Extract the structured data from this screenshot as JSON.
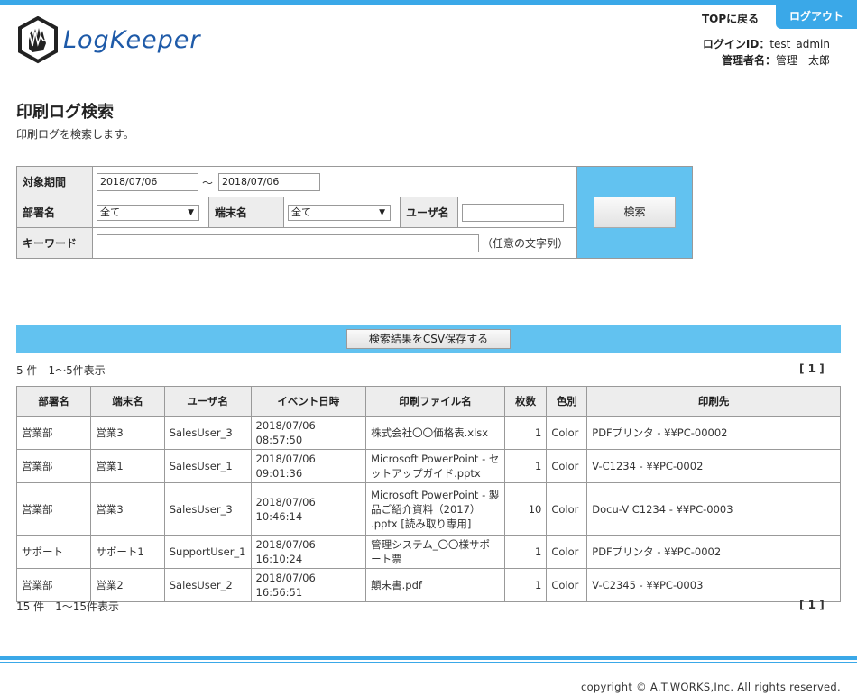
{
  "header": {
    "app_name": "LogKeeper",
    "top_link": "TOPに戻る",
    "logout": "ログアウト",
    "login_id_label": "ログインID：",
    "login_id": "test_admin",
    "manager_label": "管理者名：",
    "manager_name": "管理　太郎"
  },
  "page": {
    "title": "印刷ログ検索",
    "description": "印刷ログを検索します。"
  },
  "search": {
    "period_label": "対象期間",
    "date_from": "2018/07/06",
    "tilde": "～",
    "date_to": "2018/07/06",
    "department_label": "部署名",
    "department_value": "全て",
    "terminal_label": "端末名",
    "terminal_value": "全て",
    "user_label": "ユーザ名",
    "user_value": "",
    "keyword_label": "キーワード",
    "keyword_value": "",
    "keyword_hint": "（任意の文字列）",
    "search_button": "検索",
    "dropdown_arrow": "▼"
  },
  "csv_button": "検索結果をCSV保存する",
  "result_top": {
    "count": "5 件　1～5件表示",
    "pager": "[ 1 ]"
  },
  "result_bottom": {
    "count": "15 件　1～15件表示",
    "pager": "[ 1 ]"
  },
  "table": {
    "headers": [
      "部署名",
      "端末名",
      "ユーザ名",
      "イベント日時",
      "印刷ファイル名",
      "枚数",
      "色別",
      "印刷先"
    ],
    "rows": [
      [
        "営業部",
        "営業3",
        "SalesUser_3",
        "2018/07/06 08:57:50",
        "株式会社〇〇価格表.xlsx",
        "1",
        "Color",
        "PDFプリンタ - ¥¥PC-00002"
      ],
      [
        "営業部",
        "営業1",
        "SalesUser_1",
        "2018/07/06 09:01:36",
        "Microsoft PowerPoint - セットアップガイド.pptx",
        "1",
        "Color",
        "V-C1234 - ¥¥PC-0002"
      ],
      [
        "営業部",
        "営業3",
        "SalesUser_3",
        "2018/07/06 10:46:14",
        "Microsoft PowerPoint - 製品ご紹介資料（2017） .pptx [読み取り専用]",
        "10",
        "Color",
        "Docu-V C1234 - ¥¥PC-0003"
      ],
      [
        "サポート",
        "サポート1",
        "SupportUser_1",
        "2018/07/06 16:10:24",
        "管理システム_〇〇様サポート票",
        "1",
        "Color",
        "PDFプリンタ - ¥¥PC-0002"
      ],
      [
        "営業部",
        "営業2",
        "SalesUser_2",
        "2018/07/06 16:56:51",
        "顛末書.pdf",
        "1",
        "Color",
        "V-C2345 - ¥¥PC-0003"
      ]
    ]
  },
  "footer": {
    "copyright": "copyright © A.T.WORKS,Inc. All rights reserved."
  },
  "colors": {
    "accent": "#3aa8e8",
    "panel": "#62c2f0",
    "header_cell": "#ededed",
    "logo": "#1e5aa8"
  }
}
